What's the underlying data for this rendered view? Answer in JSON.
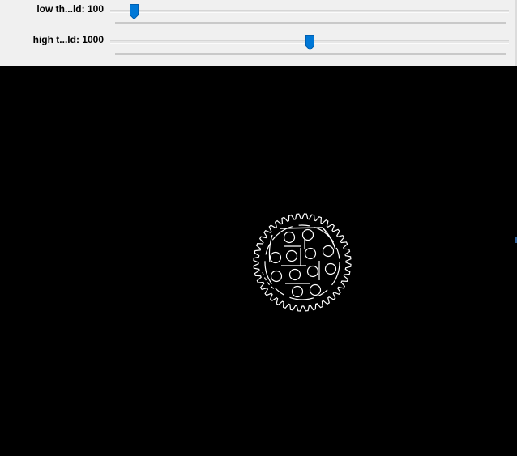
{
  "trackbars": [
    {
      "label": "low th...ld: 100",
      "value": 100,
      "fraction": 0.05
    },
    {
      "label": "high t...ld: 1000",
      "value": 1000,
      "fraction": 0.5
    }
  ],
  "colors": {
    "panel": "#f0f0f0",
    "thumb": "#0078d7",
    "canvas": "#000000",
    "edges": "#ffffff"
  }
}
